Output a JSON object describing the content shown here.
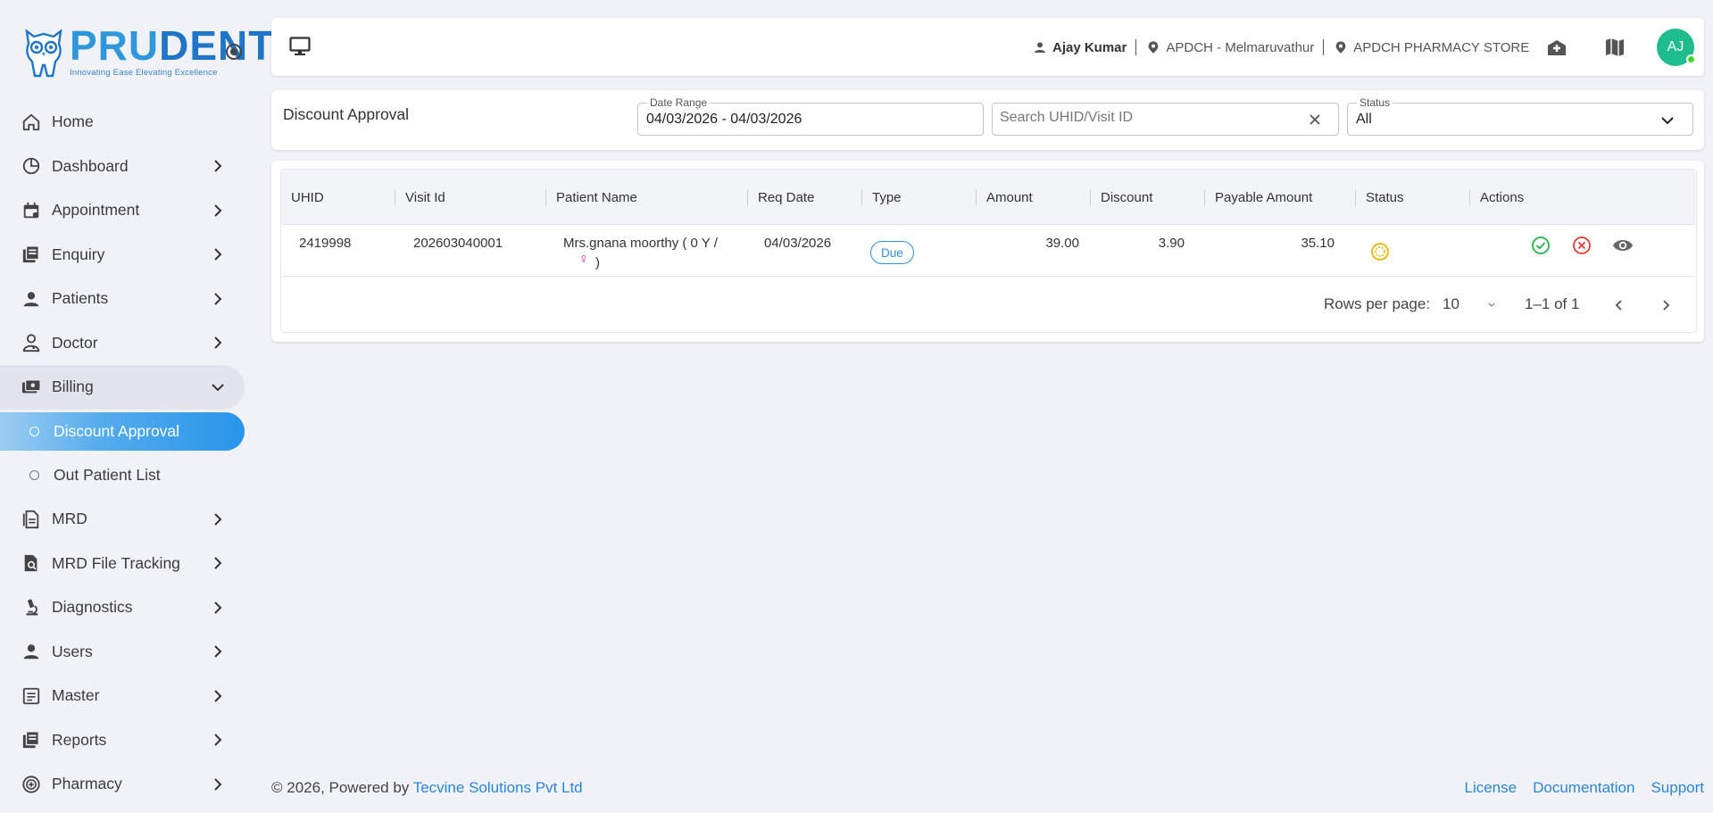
{
  "brand": {
    "name_part1": "PRU",
    "name_part2": "DENT",
    "tagline": "Innovating Ease Elevating Excellence"
  },
  "sidebar": {
    "items": [
      {
        "label": "Home",
        "icon": "home-icon"
      },
      {
        "label": "Dashboard",
        "icon": "pie-chart-icon"
      },
      {
        "label": "Appointment",
        "icon": "calendar-icon"
      },
      {
        "label": "Enquiry",
        "icon": "documents-icon"
      },
      {
        "label": "Patients",
        "icon": "person-icon"
      },
      {
        "label": "Doctor",
        "icon": "doctor-icon"
      },
      {
        "label": "Billing",
        "icon": "billing-icon"
      },
      {
        "label": "MRD",
        "icon": "document-icon"
      },
      {
        "label": "MRD File Tracking",
        "icon": "file-search-icon"
      },
      {
        "label": "Diagnostics",
        "icon": "microscope-icon"
      },
      {
        "label": "Users",
        "icon": "person-icon"
      },
      {
        "label": "Master",
        "icon": "list-box-icon"
      },
      {
        "label": "Reports",
        "icon": "reports-icon"
      },
      {
        "label": "Pharmacy",
        "icon": "pharmacy-icon"
      }
    ],
    "billing_sub": [
      {
        "label": "Discount Approval"
      },
      {
        "label": "Out Patient List"
      }
    ]
  },
  "topbar": {
    "user": "Ajay Kumar",
    "location": "APDCH - Melmaruvathur",
    "store": "APDCH PHARMACY STORE",
    "avatar_initials": "AJ"
  },
  "filters": {
    "title": "Discount Approval",
    "date_range_label": "Date Range",
    "date_range_value": "04/03/2026 - 04/03/2026",
    "search_placeholder": "Search UHID/Visit ID",
    "status_label": "Status",
    "status_value": "All"
  },
  "table": {
    "columns": [
      "UHID",
      "Visit Id",
      "Patient Name",
      "Req Date",
      "Type",
      "Amount",
      "Discount",
      "Payable Amount",
      "Status",
      "Actions"
    ],
    "rows": [
      {
        "uhid": "2419998",
        "visit_id": "202603040001",
        "patient_name": "Mrs.gnana moorthy ( 0 Y /",
        "patient_gender_symbol": "♀",
        "patient_name_end": ")",
        "req_date": "04/03/2026",
        "type": "Due",
        "amount": "39.00",
        "discount": "3.90",
        "payable": "35.10",
        "status_icon": "pending-icon"
      }
    ],
    "pagination": {
      "rows_per_page_label": "Rows per page:",
      "rows_per_page": "10",
      "range": "1–1 of 1"
    }
  },
  "footer": {
    "copyright": "© 2026, Powered by ",
    "company": "Tecvine Solutions Pvt Ltd",
    "links": [
      "License",
      "Documentation",
      "Support"
    ]
  },
  "colors": {
    "accent": "#2795ea",
    "avatar": "#1fbd8e",
    "approve": "#22b24c",
    "reject": "#e53935",
    "pending": "#e6b800"
  }
}
